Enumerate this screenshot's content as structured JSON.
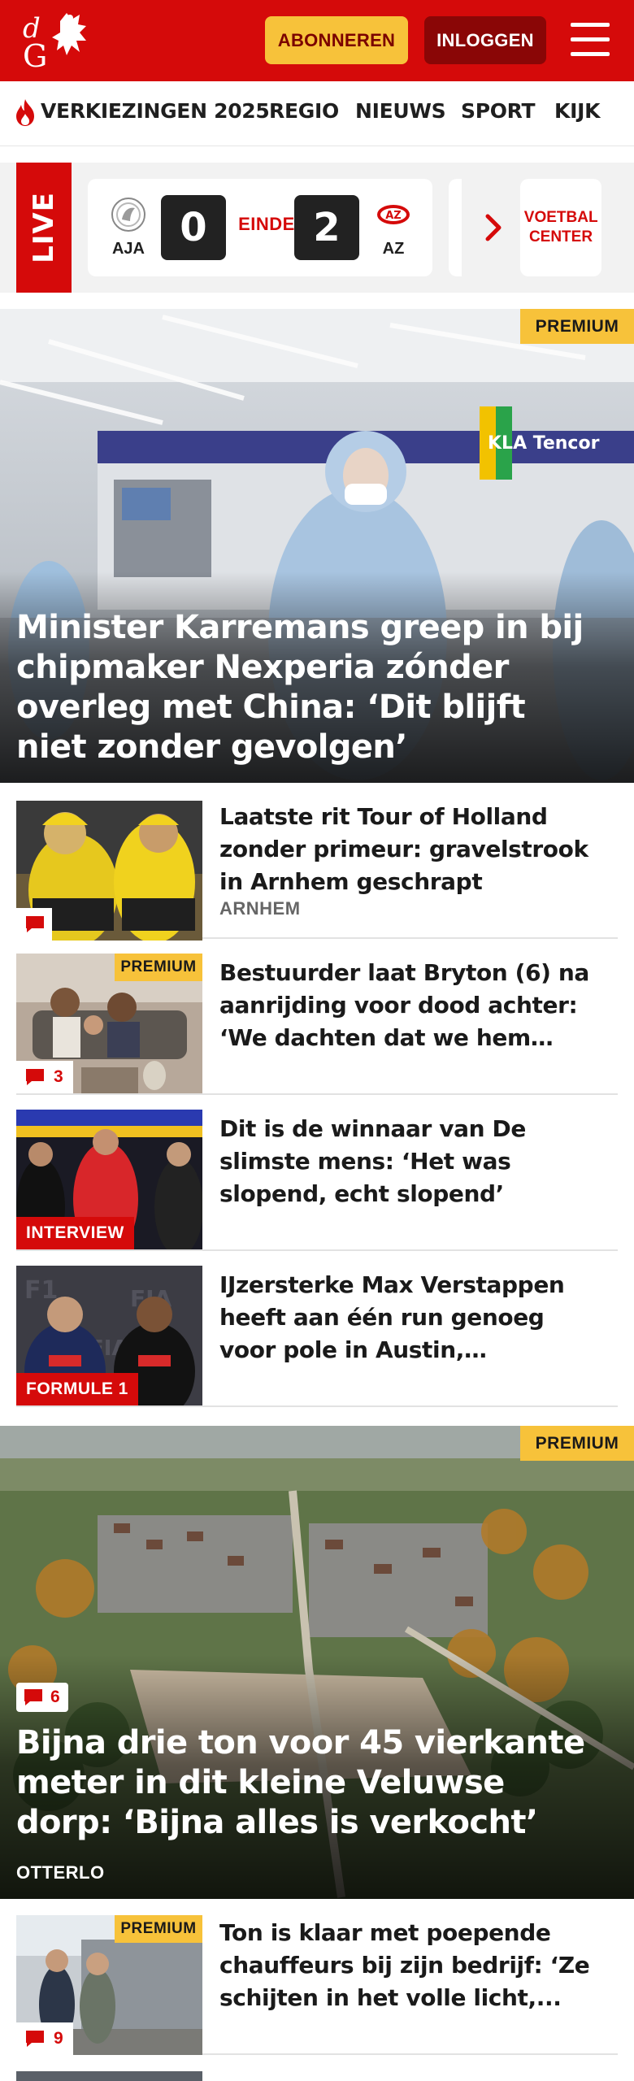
{
  "header": {
    "subscribe_label": "ABONNEREN",
    "login_label": "INLOGGEN",
    "logo_letters": "dG",
    "menu_icon": "hamburger-icon"
  },
  "nav": {
    "items": [
      {
        "label": "VERKIEZINGEN 2025",
        "icon": "flame-icon"
      },
      {
        "label": "REGIO"
      },
      {
        "label": "NIEUWS"
      },
      {
        "label": "SPORT"
      },
      {
        "label": "KIJK"
      }
    ]
  },
  "live": {
    "label": "LIVE",
    "match": {
      "home": "AJA",
      "home_score": "0",
      "status": "EINDE",
      "away_score": "2",
      "away": "AZ"
    },
    "center_label": "VOETBAL CENTER"
  },
  "hero1": {
    "badge": "PREMIUM",
    "title": "Minister Karremans greep in bij chipmaker Nexperia zónder overleg met China: ‘Dit blijft niet zonder gevolgen’"
  },
  "articles": [
    {
      "title": "Laatste rit Tour of Holland zonder primeur: gravelstrook in Arnhem geschrapt",
      "location": "ARNHEM",
      "comments": ""
    },
    {
      "title": "Bestuurder laat Bryton (6) na aanrijding voor dood achter: ‘We dachten dat we hem konden ga...",
      "badge": "PREMIUM",
      "comments": "3"
    },
    {
      "title": "Dit is de winnaar van De slimste mens: ‘Het was slopend, echt slopend’",
      "category": "INTERVIEW"
    },
    {
      "title": "IJzersterke Max Verstappen heeft aan één run genoeg voor pole in Austin, dramatische dag...",
      "category": "FORMULE 1"
    }
  ],
  "hero2": {
    "badge": "PREMIUM",
    "comments": "6",
    "title": "Bijna drie ton voor 45 vierkante meter in dit kleine Veluwse dorp: ‘Bijna alles is verkocht’",
    "location": "OTTERLO"
  },
  "article_last": {
    "title": "Ton is klaar met poepende chauffeurs bij zijn bedrijf: ‘Ze schijten in het volle licht,...",
    "badge": "PREMIUM",
    "comments": "9"
  },
  "colors": {
    "brand_red": "#d50a0a",
    "subscribe_yellow": "#f7c23a",
    "login_dark_red": "#8a0606"
  }
}
